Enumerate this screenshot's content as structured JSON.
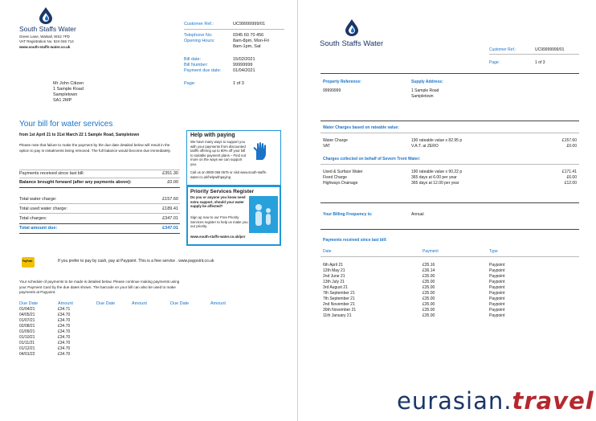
{
  "page1": {
    "company_name": "South Staffs Water",
    "address_line1": "Green Lane, Walsall, WS2 7PD",
    "address_line2": "VAT Registration No. 524 046 714",
    "website": "www.south-staffs-water.co.uk",
    "meta": [
      {
        "label": "Customer Ref.:",
        "value": "UC99999999/01"
      },
      {
        "label": "Telephone No:",
        "value": "0345 60 70 456"
      },
      {
        "label": "Opening Hours:",
        "value": "8am-8pm, Mon-Fri"
      },
      {
        "label": "",
        "value": "8am-1pm, Sat"
      }
    ],
    "dates": [
      {
        "label": "Bill date:",
        "value": "15/02/2021"
      },
      {
        "label": "Bill Number:",
        "value": "99999999"
      },
      {
        "label": "Payment due date:",
        "value": "01/04/2021"
      }
    ],
    "page_label": "Page:",
    "page_value": "1 of 3",
    "recipient": [
      "Mr John Citizen",
      "1 Sample Road",
      "Sampletown",
      "SA1 2MP"
    ],
    "bill_title": "Your bill for water services",
    "bill_subtitle": "from 1st April 21 to 31st March 22 1 Sample Road, Sampletown",
    "bill_intro": "Please note that failure to make the payment by the due date detailed below will result in the option to pay in instalments being removed. The full balance would become due immediately.",
    "summary": [
      {
        "label": "Payments received since last bill:",
        "value": "£351.30",
        "bold": false
      },
      {
        "label": "Balance brought forward (after any payments above):",
        "value": "£0.00",
        "bold": true
      },
      {
        "label": "Total water charge:",
        "value": "£157.60",
        "bold": false
      },
      {
        "label": "Total used water charge:",
        "value": "£189.41",
        "bold": false
      },
      {
        "label": "Total charges:",
        "value": "£347.01",
        "bold": false
      },
      {
        "label": "Total amount due:",
        "value": "£347.01",
        "bold": true
      }
    ],
    "help_title": "Help with paying",
    "help_text": "We have many ways to support you with your payments from discounted tariffs offering up to 80% off your bill to suitable payment plans – Find out more on the ways we can support you.",
    "help_contact": "Call us on 0800 055 0575 or visit www.south-staffs-water.co.uk/helpwithpaying",
    "priority_title": "Priority Services Register",
    "priority_bold": "Do you or anyone you know need extra support, should your water supply be affected?",
    "priority_text": "Sign up now to our Free Priority Services register to help us make you our priority.",
    "priority_link": "www.south-staffs-water.co.uk/psr",
    "paypoint_label": "PayPoint",
    "paypoint_text": "If you prefer to pay by cash, pay at Paypoint. This is a free service . www.paypoint.co.uk",
    "schedule_intro": "Your schedule of payments to be made is detailed below. Please continue making payments using your Payment Card by the due dates shown. The barcode on your bill can also be used to make payments at Paypoint.",
    "schedule_headers": [
      "Due Date",
      "Amount",
      "Due Date",
      "Amount",
      "Due Date",
      "Amount"
    ],
    "schedule": [
      {
        "date": "01/04/21",
        "amount": "£34.71"
      },
      {
        "date": "04/05/21",
        "amount": "£34.70"
      },
      {
        "date": "01/07/21",
        "amount": "£34.70"
      },
      {
        "date": "02/08/21",
        "amount": "£34.70"
      },
      {
        "date": "01/09/21",
        "amount": "£34.70"
      },
      {
        "date": "01/10/21",
        "amount": "£34.70"
      },
      {
        "date": "01/11/21",
        "amount": "£34.70"
      },
      {
        "date": "01/12/21",
        "amount": "£34.70"
      },
      {
        "date": "04/01/22",
        "amount": "£34.70"
      }
    ]
  },
  "page2": {
    "company_name": "South Staffs Water",
    "customer_ref_label": "Customer Ref.:",
    "customer_ref_value": "UC99999999/01",
    "page_label": "Page:",
    "page_value": "1 of 3",
    "property_ref_label": "Property Reference:",
    "property_ref_value": "99999999",
    "supply_address_label": "Supply Address:",
    "supply_address": [
      "1 Sample Road",
      "Sampletown"
    ],
    "water_section_title": "Water Charges based on rateable value:",
    "water_rows": [
      {
        "item": "Water Charge",
        "detail": "190 rateable value x 82.95 p",
        "amount": "£157.60"
      },
      {
        "item": "VAT",
        "detail": "V.A.T. at ZERO",
        "amount": "£0.00"
      }
    ],
    "severn_section_title": "Charges collected on behalf of Severn Trent Water:",
    "severn_rows": [
      {
        "item": "Used & Surface Water",
        "detail": "190 rateable value x 90.22 p",
        "amount": "£171.41"
      },
      {
        "item": "Fixed Charge",
        "detail": "365 days at 6.00 per year",
        "amount": "£6.00"
      },
      {
        "item": "Highways Drainage",
        "detail": "365 days at 12.00 per year",
        "amount": "£12.00"
      }
    ],
    "billing_freq_label": "Your Billing Frequency is:",
    "billing_freq_value": "Annual",
    "payments_title": "Payments received since last bill:",
    "payments_headers": [
      "Date",
      "Payment",
      "Type"
    ],
    "payments": [
      {
        "date": "6th April 21",
        "payment": "£35.16",
        "type": "Paypoint"
      },
      {
        "date": "12th May 21",
        "payment": "£36.14",
        "type": "Paypoint"
      },
      {
        "date": "2nd June 21",
        "payment": "£35.00",
        "type": "Paypoint"
      },
      {
        "date": "13th July 21",
        "payment": "£35.00",
        "type": "Paypoint"
      },
      {
        "date": "3rd August 21",
        "payment": "£35.00",
        "type": "Paypoint"
      },
      {
        "date": "7th September 21",
        "payment": "£35.00",
        "type": "Paypoint"
      },
      {
        "date": "7th September 21",
        "payment": "£35.00",
        "type": "Paypoint"
      },
      {
        "date": "2nd November 21",
        "payment": "£35.00",
        "type": "Paypoint"
      },
      {
        "date": "30th November 21",
        "payment": "£35.00",
        "type": "Paypoint"
      },
      {
        "date": "11th January 21",
        "payment": "£35.00",
        "type": "Paypoint"
      }
    ]
  },
  "watermark": {
    "part1": "eurasian.",
    "part2": "travel"
  },
  "colors": {
    "accent_blue": "#1a73c6",
    "navy": "#1b3668",
    "box_blue": "#2196d9",
    "watermark_red": "#b5282e"
  }
}
